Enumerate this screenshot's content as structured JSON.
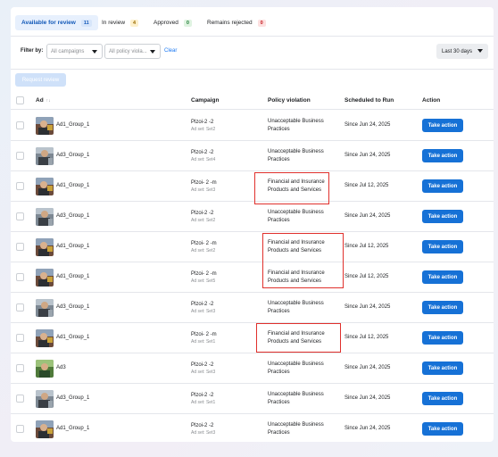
{
  "tabs": [
    {
      "label": "Available for review",
      "count": "11",
      "badge": "b-blue",
      "active": true
    },
    {
      "label": "In review",
      "count": "4",
      "badge": "b-yellow",
      "active": false
    },
    {
      "label": "Approved",
      "count": "0",
      "badge": "b-green",
      "active": false
    },
    {
      "label": "Remains rejected",
      "count": "0",
      "badge": "b-red",
      "active": false
    }
  ],
  "filters": {
    "label": "Filter by:",
    "campaigns_placeholder": "All campaigns",
    "policy_placeholder": "All policy viola...",
    "clear": "Clear",
    "date_range": "Last 30 days"
  },
  "request_review_label": "Request review",
  "columns": {
    "ad": "Ad",
    "sort_icon": "↑↓",
    "campaign": "Campaign",
    "policy": "Policy violation",
    "scheduled": "Scheduled to Run",
    "action": "Action"
  },
  "action_label": "Take action",
  "rows": [
    {
      "ad": "Ad1_Group_1",
      "campaign": "Plzoi-2 -2",
      "adset": "Ad set: Set2",
      "policy": "Unacceptable Business Practices",
      "scheduled": "Since Jun 24, 2025",
      "thumb": "a"
    },
    {
      "ad": "Ad3_Group_1",
      "campaign": "Plzoi-2 -2",
      "adset": "Ad set: Set4",
      "policy": "Unacceptable Business Practices",
      "scheduled": "Since Jun 24, 2025",
      "thumb": "b"
    },
    {
      "ad": "Ad1_Group_1",
      "campaign": "Plzoi- 2 -m",
      "adset": "Ad set: Set3",
      "policy": "Financial and Insurance Products and Services",
      "scheduled": "Since Jul 12, 2025",
      "thumb": "a"
    },
    {
      "ad": "Ad3_Group_1",
      "campaign": "Plzoi-2 -2",
      "adset": "Ad set: Set2",
      "policy": "Unacceptable Business Practices",
      "scheduled": "Since Jun 24, 2025",
      "thumb": "b"
    },
    {
      "ad": "Ad1_Group_1",
      "campaign": "Plzoi- 2 -m",
      "adset": "Ad set: Set2",
      "policy": "Financial and Insurance Products and Services",
      "scheduled": "Since Jul 12, 2025",
      "thumb": "a"
    },
    {
      "ad": "Ad1_Group_1",
      "campaign": "Plzoi- 2 -m",
      "adset": "Ad set: Set5",
      "policy": "Financial and Insurance Products and Services",
      "scheduled": "Since Jul 12, 2025",
      "thumb": "a"
    },
    {
      "ad": "Ad3_Group_1",
      "campaign": "Plzoi-2 -2",
      "adset": "Ad set: Set3",
      "policy": "Unacceptable Business Practices",
      "scheduled": "Since Jun 24, 2025",
      "thumb": "b"
    },
    {
      "ad": "Ad1_Group_1",
      "campaign": "Plzoi- 2 -m",
      "adset": "Ad set: Set1",
      "policy": "Financial and Insurance Products and Services",
      "scheduled": "Since Jul 12, 2025",
      "thumb": "a"
    },
    {
      "ad": "Ad3",
      "campaign": "Plzoi-2 -2",
      "adset": "Ad set: Set3",
      "policy": "Unacceptable Business Practices",
      "scheduled": "Since Jun 24, 2025",
      "thumb": "c"
    },
    {
      "ad": "Ad3_Group_1",
      "campaign": "Plzoi-2 -2",
      "adset": "Ad set: Set1",
      "policy": "Unacceptable Business Practices",
      "scheduled": "Since Jun 24, 2025",
      "thumb": "b"
    },
    {
      "ad": "Ad1_Group_1",
      "campaign": "Plzoi-2 -2",
      "adset": "Ad set: Set3",
      "policy": "Unacceptable Business Practices",
      "scheduled": "Since Jun 24, 2025",
      "thumb": "a"
    }
  ],
  "highlight_color": "#e0302c",
  "accent_color": "#1671d6"
}
